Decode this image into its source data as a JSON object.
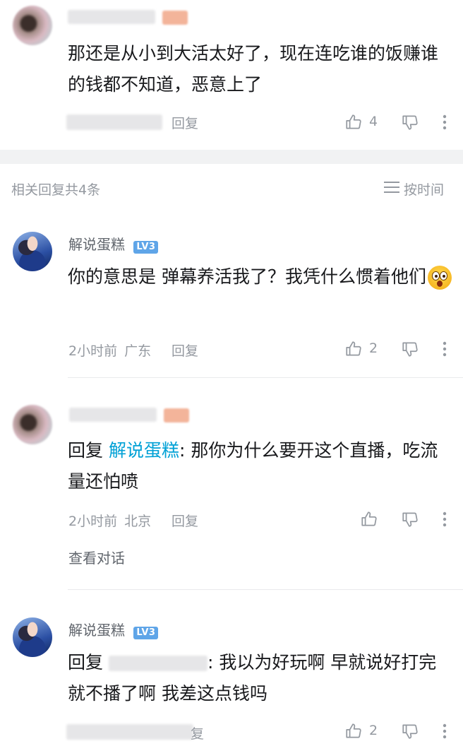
{
  "top_comment": {
    "content": "那还是从小到大活太好了，现在连吃谁的饭赚谁的钱都不知道，恶意上了",
    "reply_label": "回复",
    "like_count": "4"
  },
  "section": {
    "title": "相关回复共4条",
    "sort_label": "按时间"
  },
  "replies": [
    {
      "username": "解说蛋糕",
      "level": "LV3",
      "content": "你的意思是 弹幕养活我了？我凭什么惯着他们",
      "time": "2小时前",
      "location": "广东",
      "reply_label": "回复",
      "like_count": "2"
    },
    {
      "reply_prefix": "回复",
      "reply_to": "解说蛋糕",
      "content": ": 那你为什么要开这个直播，吃流量还怕喷",
      "time": "2小时前",
      "location": "北京",
      "reply_label": "回复",
      "view_conversation": "查看对话"
    },
    {
      "username": "解说蛋糕",
      "level": "LV3",
      "reply_prefix": "回复",
      "content": ": 我以为好玩啊 早就说好打完就不播了啊 我差这点钱吗",
      "reply_label_partial": "复",
      "like_count": "2"
    }
  ],
  "icons": {
    "like": "thumbs-up-icon",
    "dislike": "thumbs-down-icon",
    "more": "more-vertical-icon",
    "sort": "list-icon",
    "emoji": "surprised-face-emoji"
  },
  "colors": {
    "text": "#18191c",
    "secondary": "#9499a0",
    "link": "#00a1d6",
    "level_badge": "#5fa5e8"
  }
}
